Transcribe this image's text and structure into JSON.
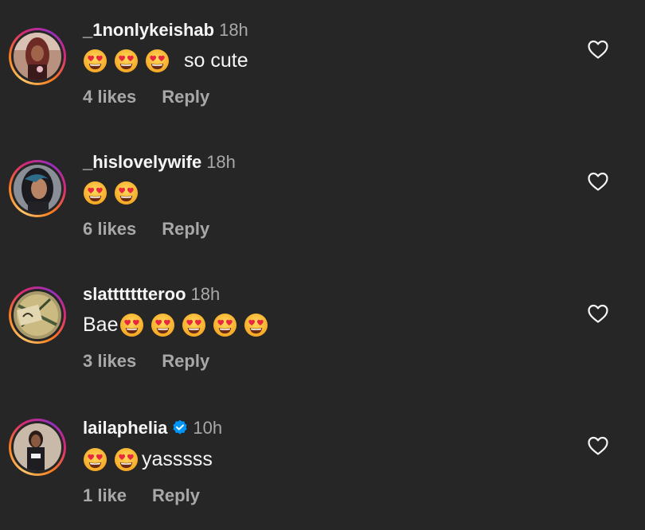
{
  "colors": {
    "background": "#262626",
    "text_primary": "#f5f5f5",
    "text_secondary": "#a8a8a8",
    "verified_badge": "#0095f6"
  },
  "comments": [
    {
      "username": "_1nonlykeishab",
      "time": "18h",
      "emoji_count": 3,
      "text": "so cute",
      "likes": "4 likes",
      "reply": "Reply",
      "verified": false,
      "icon": "heart-outline-icon"
    },
    {
      "username": "_hislovelywife",
      "time": "18h",
      "emoji_count": 2,
      "text": "",
      "likes": "6 likes",
      "reply": "Reply",
      "verified": false,
      "icon": "heart-outline-icon"
    },
    {
      "username": "slattttttteroo",
      "time": "18h",
      "emoji_count": 5,
      "text": "Bae",
      "likes": "3 likes",
      "reply": "Reply",
      "verified": false,
      "icon": "heart-outline-icon"
    },
    {
      "username": "lailaphelia",
      "time": "10h",
      "emoji_count": 2,
      "text": "yasssss",
      "likes": "1 like",
      "reply": "Reply",
      "verified": true,
      "icon": "heart-outline-icon"
    }
  ]
}
